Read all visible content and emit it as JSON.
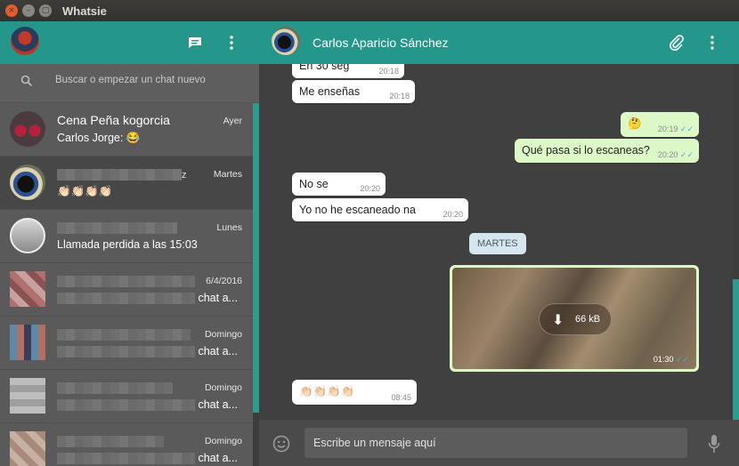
{
  "window": {
    "title": "Whatsie"
  },
  "titlebar": {
    "close": "×",
    "minimize": "–",
    "maximize": "□"
  },
  "sidebar": {
    "search_placeholder": "Buscar o empezar un chat nuevo",
    "chats": [
      {
        "name": "Cena Peña kogorcia",
        "preview": "Carlos Jorge: 😂",
        "time": "Ayer"
      },
      {
        "name": "z",
        "preview": "👏🏻👏🏻👏🏻👏🏻",
        "time": "Martes"
      },
      {
        "name": "",
        "preview": "Llamada perdida a las 15:03",
        "time": "Lunes"
      },
      {
        "name": "",
        "preview": "chat a...",
        "time": "6/4/2016"
      },
      {
        "name": "",
        "preview": "chat a...",
        "time": "Domingo"
      },
      {
        "name": "",
        "preview": "chat a...",
        "time": "Domingo"
      },
      {
        "name": "",
        "preview": "chat a...",
        "time": "Domingo"
      }
    ]
  },
  "conversation": {
    "contact_name": "Carlos Aparicio Sánchez",
    "messages": [
      {
        "text": "En 30 seg",
        "time": "20:18"
      },
      {
        "text": "Me enseñas",
        "time": "20:18"
      },
      {
        "text": "🤔",
        "time": "20:19",
        "ticks": "✓✓"
      },
      {
        "text": "Qué pasa si lo escaneas?",
        "time": "20:20",
        "ticks": "✓✓"
      },
      {
        "text": "No se",
        "time": "20:20"
      },
      {
        "text": "Yo no he escaneado na",
        "time": "20:20"
      },
      {
        "text": "👏🏻👏🏻👏🏻👏🏻",
        "time": "08:45"
      }
    ],
    "day_separator": "MARTES",
    "media": {
      "size": "66 kB",
      "time": "01:30",
      "ticks": "✓✓"
    },
    "composer_placeholder": "Escribe un mensaje aquí"
  },
  "colors": {
    "accent": "#24968a",
    "incoming": "#ffffff",
    "outgoing": "#dcf8c6",
    "background": "#404040"
  },
  "icons": [
    "chat-icon",
    "menu-icon",
    "search-icon",
    "attach-icon",
    "emoji-icon",
    "mic-icon",
    "download-icon"
  ]
}
